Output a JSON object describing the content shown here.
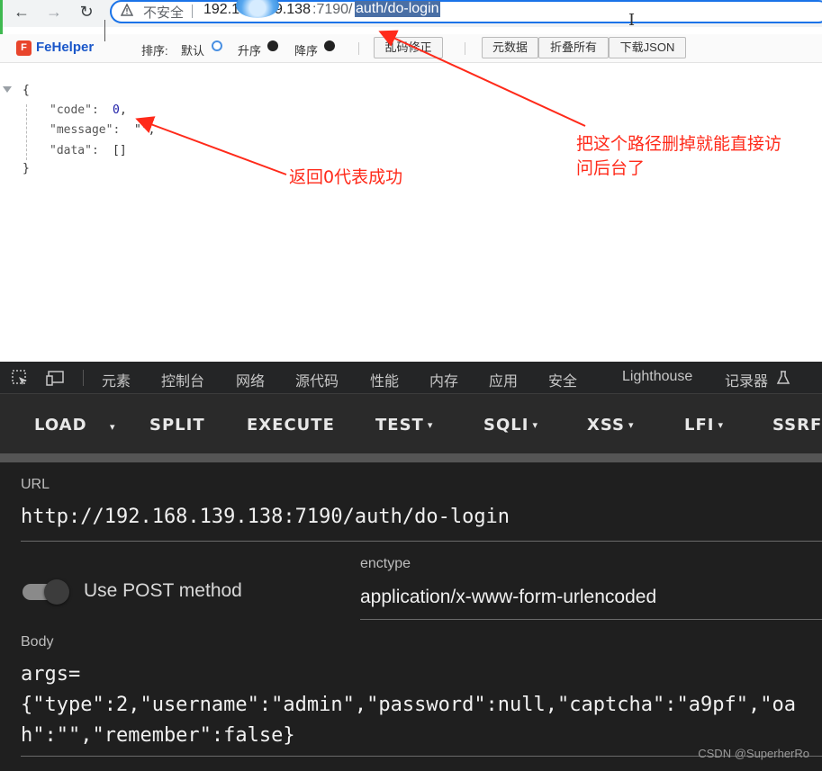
{
  "browser": {
    "insecure_label": "不安全",
    "url_host": "192.16",
    "url_host2": "9.138",
    "url_port": ":7190/",
    "url_path": "auth/do-login"
  },
  "fehelper": {
    "name": "FeHelper",
    "logo_letter": "F",
    "sort_label": "排序:",
    "sort_default": "默认",
    "sort_asc": "升序",
    "sort_desc": "降序",
    "fix_garbled": "乱码修正",
    "meta_data": "元数据",
    "collapse_all": "折叠所有",
    "download_json": "下载JSON"
  },
  "json": {
    "open_brace": "{",
    "key_code": "\"code\":",
    "val_code": "0",
    "comma": ",",
    "key_message": "\"message\":",
    "val_message": "\"\",",
    "key_data": "\"data\":",
    "val_data": "[]",
    "close_brace": "}"
  },
  "annotations": {
    "return_zero": "返回0代表成功",
    "delete_path_line1": "把这个路径删掉就能直接访",
    "delete_path_line2": "问后台了",
    "color": "#ff2a1a"
  },
  "devtools": {
    "tabs": [
      "元素",
      "控制台",
      "网络",
      "源代码",
      "性能",
      "内存",
      "应用",
      "安全",
      "Lighthouse",
      "记录器"
    ]
  },
  "hackbar": {
    "load": "LOAD",
    "split": "SPLIT",
    "execute": "EXECUTE",
    "test": "TEST",
    "sqli": "SQLI",
    "xss": "XSS",
    "lfi": "LFI",
    "ssrf": "SSRF",
    "caret": "▾"
  },
  "panel": {
    "url_label": "URL",
    "url_value": "http://192.168.139.138:7190/auth/do-login",
    "enctype_label": "enctype",
    "enctype_value": "application/x-www-form-urlencoded",
    "post_toggle_label": "Use POST method",
    "post_enabled": false,
    "body_label": "Body",
    "body_line1": "args=",
    "body_line2": "{\"type\":2,\"username\":\"admin\",\"password\":null,\"captcha\":\"a9pf\",\"oa",
    "body_line3": "h\":\"\",\"remember\":false}"
  },
  "watermark": "CSDN @SuperherRo"
}
